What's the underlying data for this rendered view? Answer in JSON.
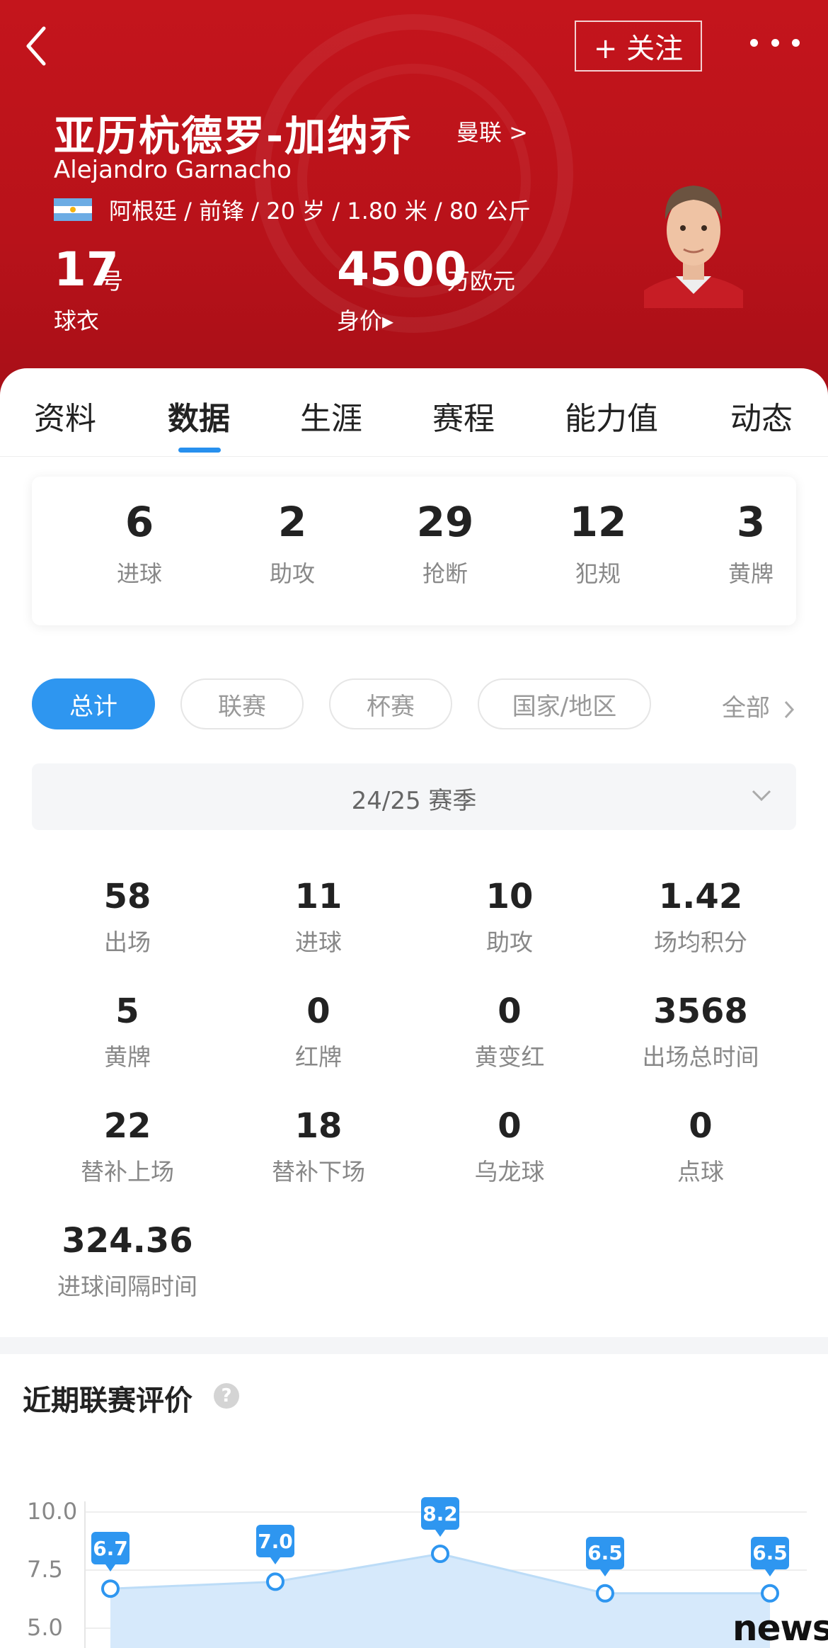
{
  "header": {
    "follow_label": "+ 关注",
    "name_cn": "亚历杭德罗-加纳乔",
    "team_link": "曼联 >",
    "name_en": "Alejandro Garnacho",
    "info": "阿根廷 / 前锋 / 20 岁 / 1.80 米 / 80 公斤",
    "shirt_number": "17",
    "shirt_unit": "号",
    "shirt_label": "球衣",
    "value": "4500",
    "value_unit": "万欧元",
    "value_label": "身价▸"
  },
  "tabs": [
    "资料",
    "数据",
    "生涯",
    "赛程",
    "能力值",
    "动态"
  ],
  "summary": [
    {
      "value": "6",
      "label": "进球"
    },
    {
      "value": "2",
      "label": "助攻"
    },
    {
      "value": "29",
      "label": "抢断"
    },
    {
      "value": "12",
      "label": "犯规"
    },
    {
      "value": "3",
      "label": "黄牌"
    }
  ],
  "filters": [
    "总计",
    "联赛",
    "杯赛",
    "国家/地区"
  ],
  "all_label": "全部",
  "season": "24/25 赛季",
  "stats": [
    {
      "value": "58",
      "label": "出场"
    },
    {
      "value": "11",
      "label": "进球"
    },
    {
      "value": "10",
      "label": "助攻"
    },
    {
      "value": "1.42",
      "label": "场均积分"
    },
    {
      "value": "5",
      "label": "黄牌"
    },
    {
      "value": "0",
      "label": "红牌"
    },
    {
      "value": "0",
      "label": "黄变红"
    },
    {
      "value": "3568",
      "label": "出场总时间"
    },
    {
      "value": "22",
      "label": "替补上场"
    },
    {
      "value": "18",
      "label": "替补下场"
    },
    {
      "value": "0",
      "label": "乌龙球"
    },
    {
      "value": "0",
      "label": "点球"
    },
    {
      "value": "324.36",
      "label": "进球间隔时间"
    }
  ],
  "rating_section": {
    "title": "近期联赛评价",
    "help": "?"
  },
  "chart_data": {
    "type": "area",
    "yticks": [
      "10.0",
      "7.5",
      "5.0"
    ],
    "values": [
      6.7,
      7.0,
      8.2,
      6.5,
      6.5
    ],
    "labels": [
      "6.7",
      "7.0",
      "8.2",
      "6.5",
      "6.5"
    ],
    "ylim": [
      5.0,
      10.0
    ]
  },
  "watermark": "news",
  "colors": {
    "brand_red": "#c4151c",
    "accent_blue": "#2e96f0"
  }
}
